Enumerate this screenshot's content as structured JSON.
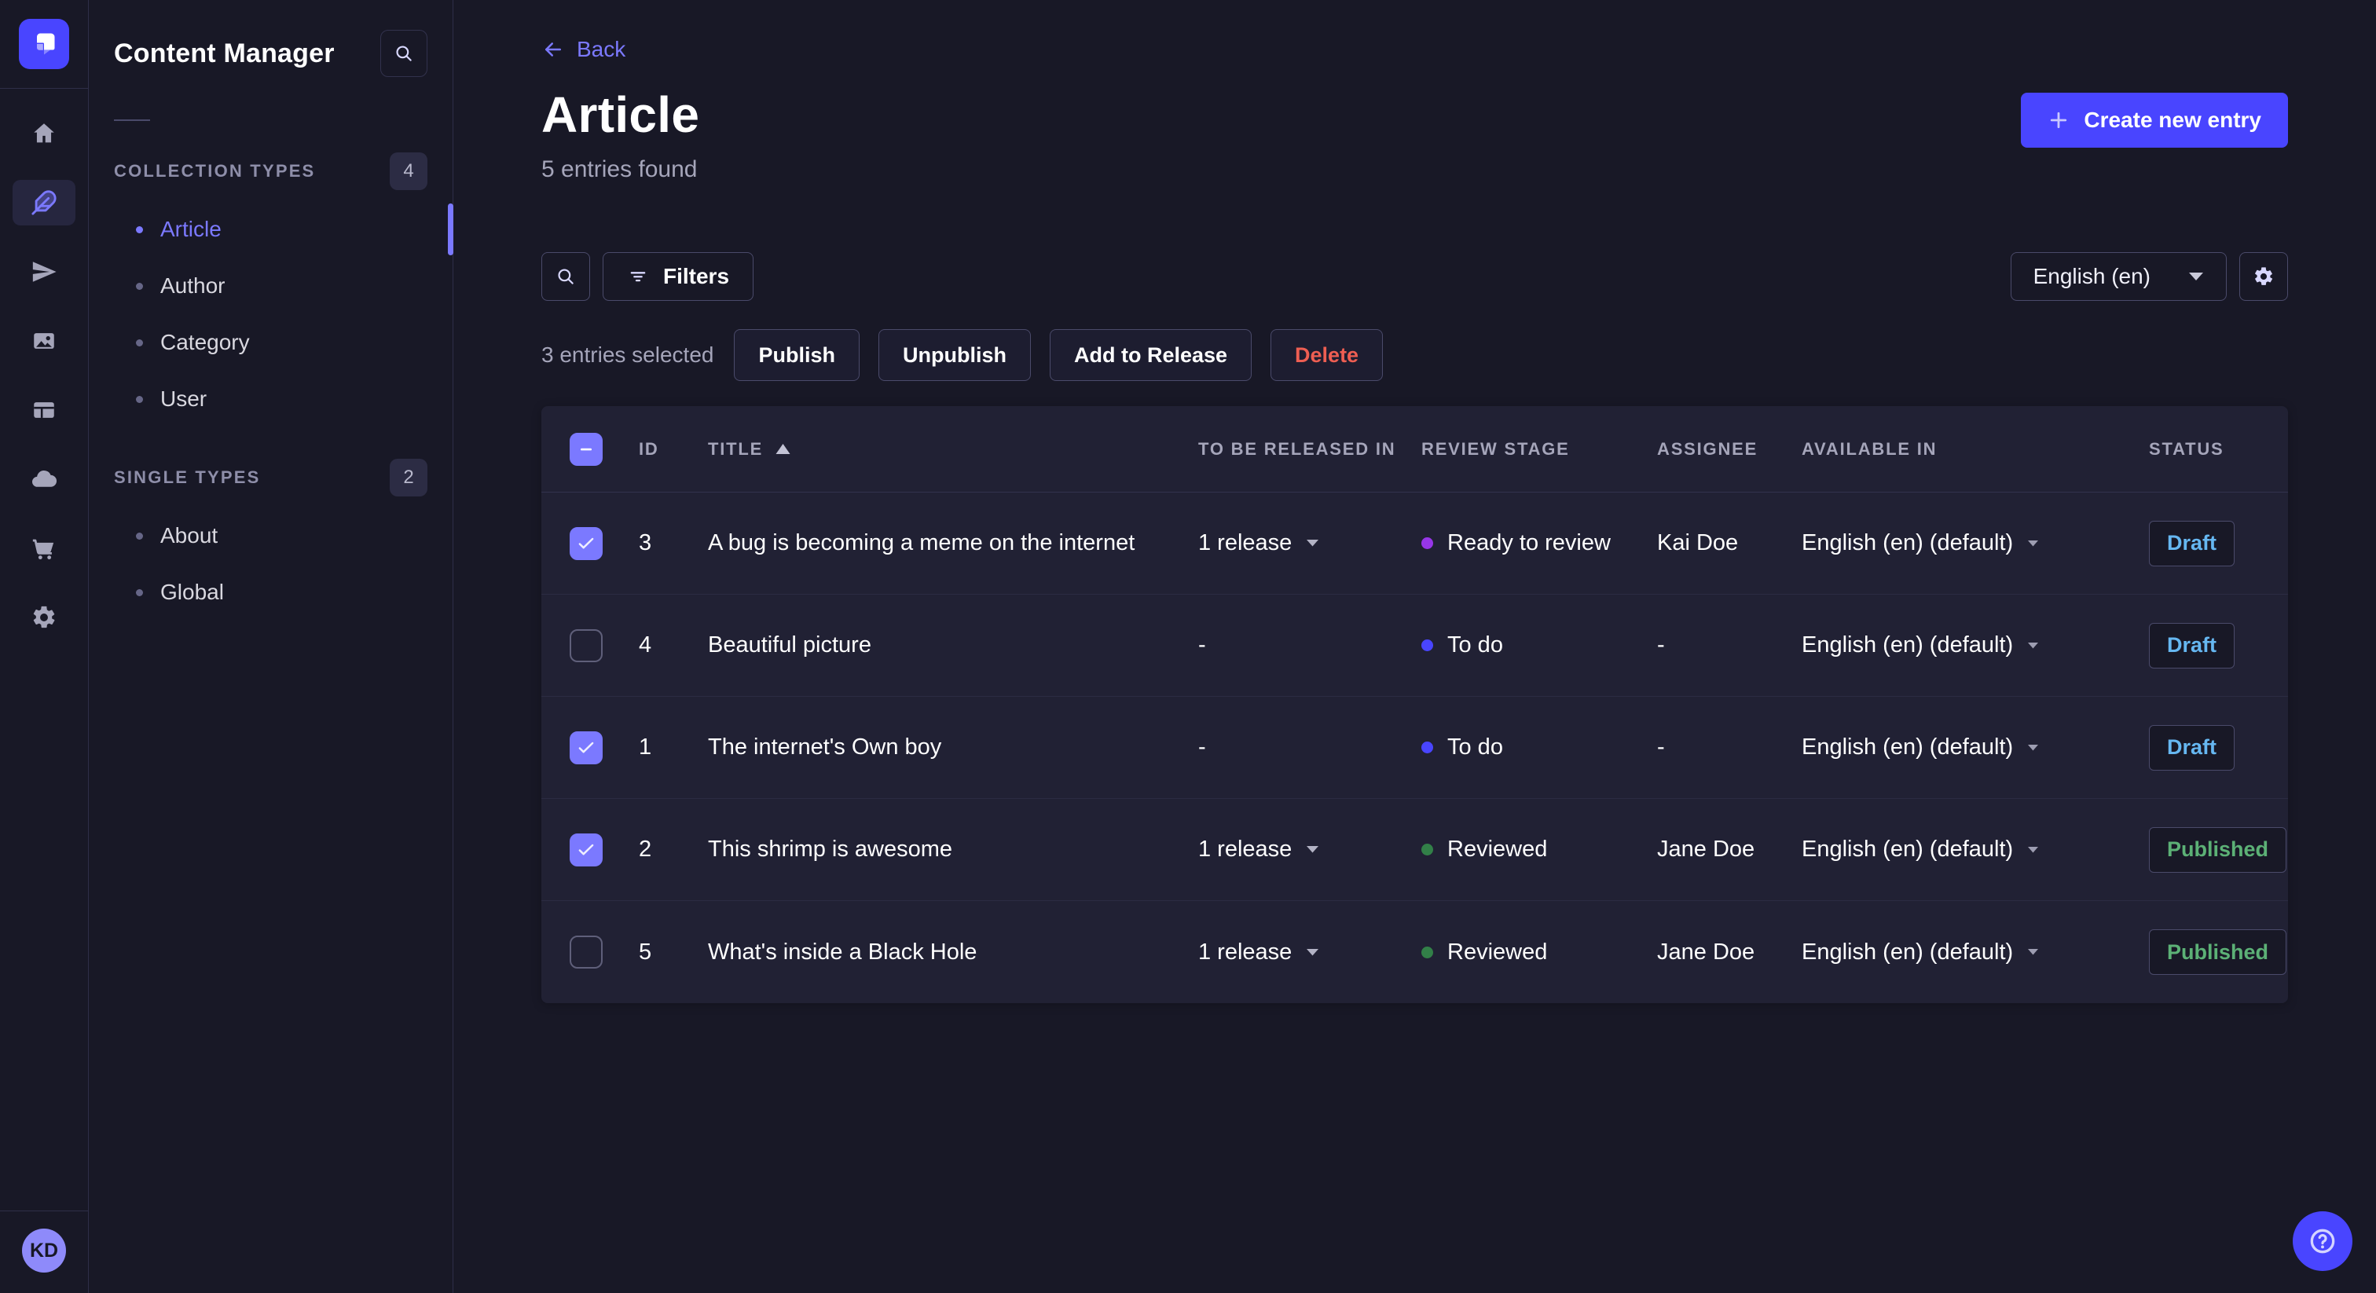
{
  "colors": {
    "primary": "#4945ff",
    "primary_light": "#7b79ff",
    "draft_text": "#66b7f1",
    "published_text": "#5cb176",
    "delete_text": "#ee5e52",
    "stage_todo": "#4945ff",
    "stage_ready": "#9736e8",
    "stage_reviewed": "#328048"
  },
  "nav_rail": {
    "user_initials": "KD"
  },
  "sidebar": {
    "title": "Content Manager",
    "sections": [
      {
        "label": "COLLECTION TYPES",
        "count": "4",
        "items": [
          {
            "label": "Article",
            "active": true
          },
          {
            "label": "Author",
            "active": false
          },
          {
            "label": "Category",
            "active": false
          },
          {
            "label": "User",
            "active": false
          }
        ]
      },
      {
        "label": "SINGLE TYPES",
        "count": "2",
        "items": [
          {
            "label": "About",
            "active": false
          },
          {
            "label": "Global",
            "active": false
          }
        ]
      }
    ]
  },
  "page": {
    "back_label": "Back",
    "title": "Article",
    "subtitle": "5 entries found",
    "create_button": "Create new entry"
  },
  "toolbar": {
    "filters_label": "Filters",
    "locale_selected": "English (en)"
  },
  "selection": {
    "label": "3 entries selected",
    "publish": "Publish",
    "unpublish": "Unpublish",
    "add_to_release": "Add to Release",
    "delete": "Delete"
  },
  "table": {
    "select_all_state": "indeterminate",
    "sort_column": "TITLE",
    "sort_direction": "asc",
    "columns": {
      "id": "ID",
      "title": "TITLE",
      "released": "TO BE RELEASED IN",
      "review": "REVIEW STAGE",
      "assignee": "ASSIGNEE",
      "available": "AVAILABLE IN",
      "status": "STATUS"
    },
    "rows": [
      {
        "checked": true,
        "id": "3",
        "title": "A bug is becoming a meme on the internet",
        "released": "1 release",
        "review": "Ready to review",
        "review_color": "#9736e8",
        "assignee": "Kai Doe",
        "available": "English (en) (default)",
        "status": "Draft"
      },
      {
        "checked": false,
        "id": "4",
        "title": "Beautiful picture",
        "released": "-",
        "review": "To do",
        "review_color": "#4945ff",
        "assignee": "-",
        "available": "English (en) (default)",
        "status": "Draft"
      },
      {
        "checked": true,
        "id": "1",
        "title": "The internet's Own boy",
        "released": "-",
        "review": "To do",
        "review_color": "#4945ff",
        "assignee": "-",
        "available": "English (en) (default)",
        "status": "Draft"
      },
      {
        "checked": true,
        "id": "2",
        "title": "This shrimp is awesome",
        "released": "1 release",
        "review": "Reviewed",
        "review_color": "#328048",
        "assignee": "Jane Doe",
        "available": "English (en) (default)",
        "status": "Published"
      },
      {
        "checked": false,
        "id": "5",
        "title": "What's inside a Black Hole",
        "released": "1 release",
        "review": "Reviewed",
        "review_color": "#328048",
        "assignee": "Jane Doe",
        "available": "English (en) (default)",
        "status": "Published"
      }
    ]
  }
}
